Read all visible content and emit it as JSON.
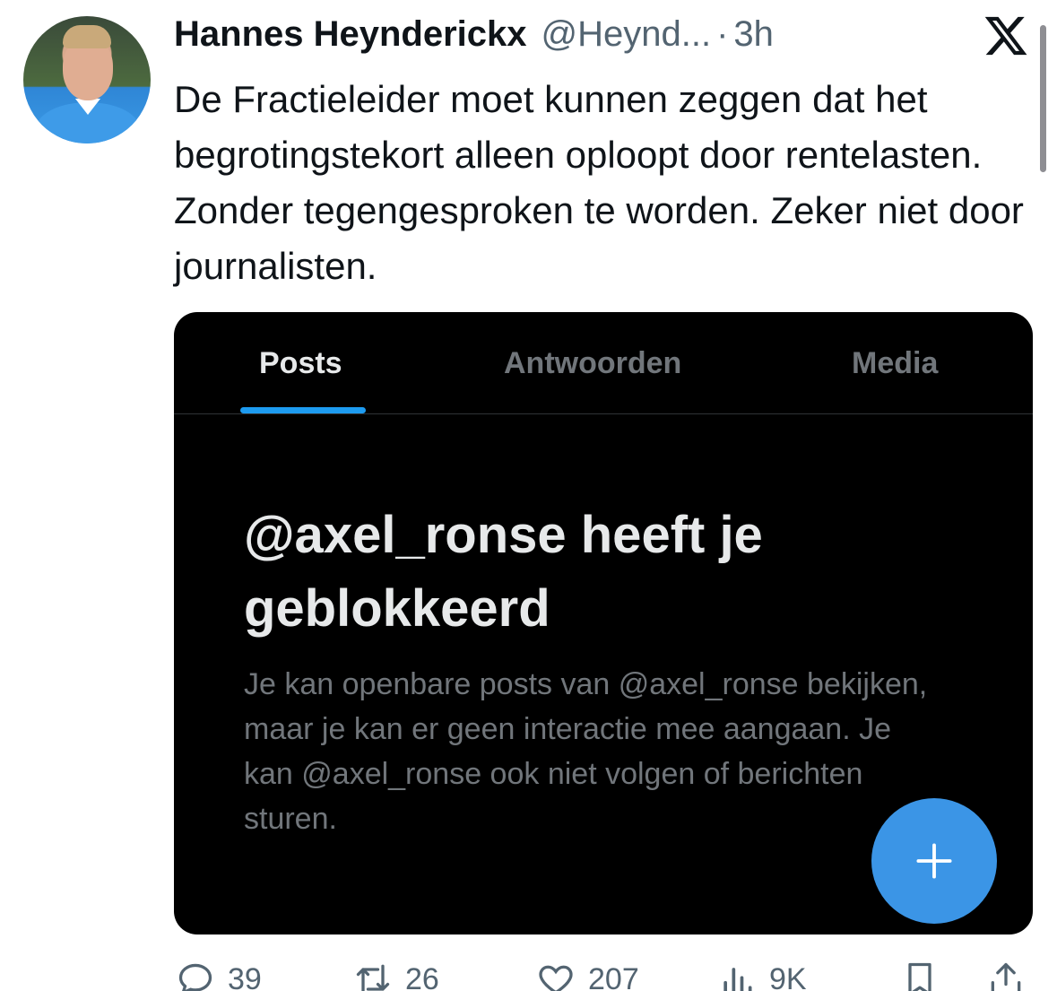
{
  "tweet": {
    "author_name": "Hannes Heynderickx",
    "handle": "@Heynd...",
    "separator": "·",
    "time": "3h",
    "text": "De Fractieleider moet kunnen zeggen dat het begrotingstekort alleen oploopt door rentelasten. Zonder tegengesproken te worden. Zeker niet door journalisten."
  },
  "media": {
    "tabs": [
      {
        "label": "Posts",
        "active": true
      },
      {
        "label": "Antwoorden",
        "active": false
      },
      {
        "label": "Media",
        "active": false
      }
    ],
    "blocked_title": "@axel_ronse heeft je geblokkeerd",
    "blocked_description": "Je kan openbare posts van @axel_ronse bekijken, maar je kan er geen interactie mee aangaan. Je kan @axel_ronse ook niet volgen of berichten sturen.",
    "fab_icon": "plus-icon"
  },
  "actions": {
    "replies": "39",
    "reposts": "26",
    "likes": "207",
    "views": "9K"
  },
  "colors": {
    "accent": "#1d9bf0",
    "media_background": "#000000",
    "secondary_text": "#536471"
  }
}
